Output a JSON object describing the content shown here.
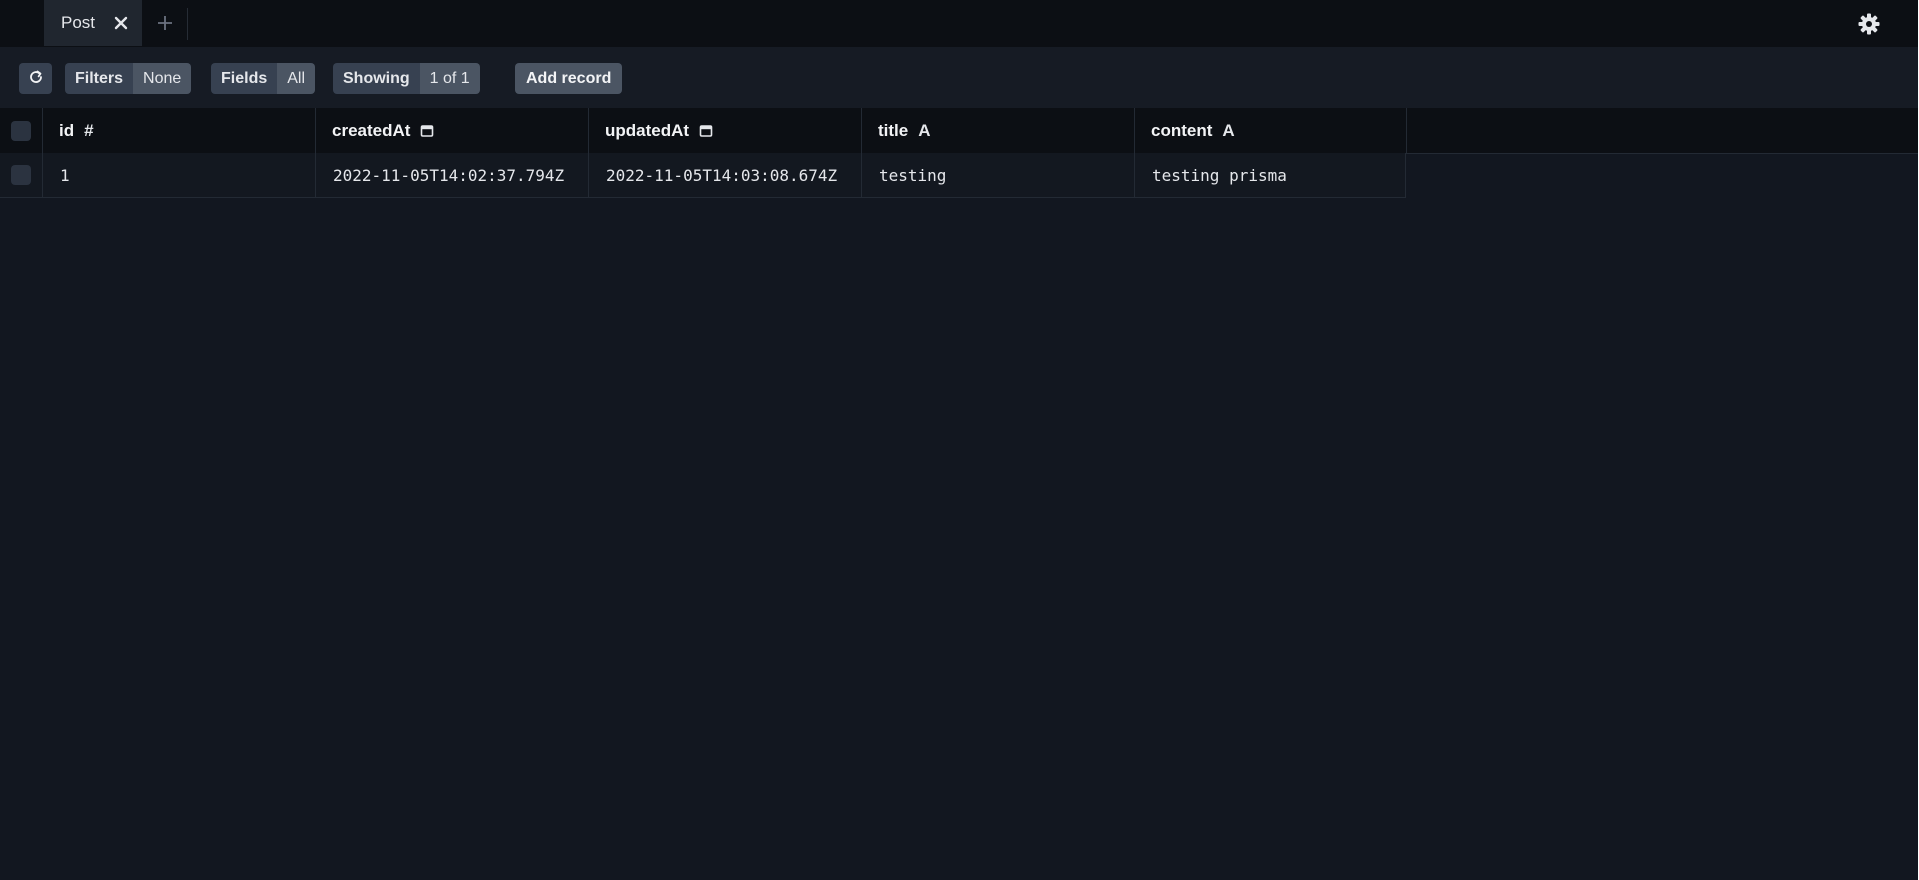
{
  "tabs": [
    {
      "label": "Post"
    }
  ],
  "toolbar": {
    "filters_label": "Filters",
    "filters_value": "None",
    "fields_label": "Fields",
    "fields_value": "All",
    "showing_label": "Showing",
    "showing_value": "1 of 1",
    "add_record_label": "Add record"
  },
  "table": {
    "columns": [
      {
        "name": "id",
        "type_icon": "hash-icon",
        "type_glyph": "#"
      },
      {
        "name": "createdAt",
        "type_icon": "calendar-icon"
      },
      {
        "name": "updatedAt",
        "type_icon": "calendar-icon"
      },
      {
        "name": "title",
        "type_icon": "text-type-icon",
        "type_glyph": "A"
      },
      {
        "name": "content",
        "type_icon": "text-type-icon",
        "type_glyph": "A"
      }
    ],
    "rows": [
      [
        "1",
        "2022-11-05T14:02:37.794Z",
        "2022-11-05T14:03:08.674Z",
        "testing",
        "testing prisma"
      ]
    ]
  },
  "colors": {
    "background": "#121720",
    "tabbar": "#0c0f14",
    "button": "#374151",
    "button_value": "#4b5563"
  }
}
